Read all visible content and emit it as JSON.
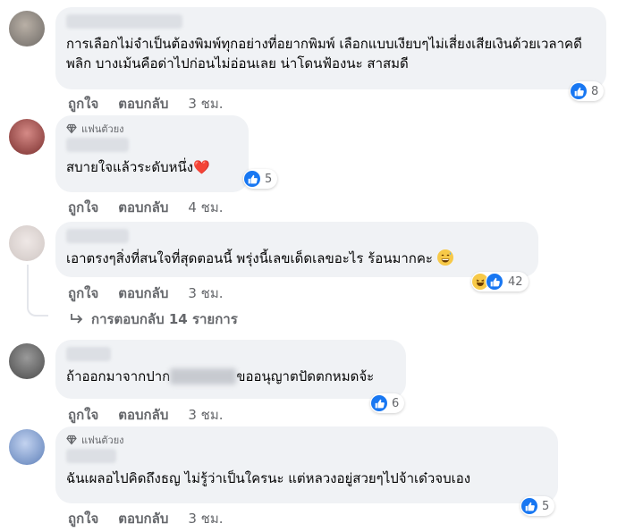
{
  "comments": [
    {
      "badge": "",
      "text": "การเลือกไม่จำเป็นต้องพิมพ์ทุกอย่างที่อยากพิมพ์ เลือกแบบเงียบๆไม่เสี่ยงเสียเงินด้วยเวลาคดีพลิก บางเม้นคือด่าไปก่อนไม่อ่อนเลย น่าโดนฟ้องนะ สาสมดี",
      "reaction_count": "8",
      "like_label": "ถูกใจ",
      "reply_label": "ตอบกลับ",
      "time": "3 ชม."
    },
    {
      "badge": "แฟนตัวยง",
      "text": "สบายใจแล้วระดับหนึ่ง",
      "emoji": "❤️",
      "reaction_count": "5",
      "like_label": "ถูกใจ",
      "reply_label": "ตอบกลับ",
      "time": "4 ชม."
    },
    {
      "badge": "",
      "text": "เอาตรงๆสิ่งที่สนใจที่สุดตอนนี้ พรุ่งนี้เลขเด็ดเลขอะไร ร้อนมากคะ",
      "reaction_count": "42",
      "like_label": "ถูกใจ",
      "reply_label": "ตอบกลับ",
      "time": "3 ชม.",
      "replies_label": "การตอบกลับ 14 รายการ"
    },
    {
      "badge": "",
      "text_before": "ถ้าออกมาจากปาก",
      "text_after": "ขออนุญาตปัดตกหมดจ้ะ",
      "reaction_count": "6",
      "like_label": "ถูกใจ",
      "reply_label": "ตอบกลับ",
      "time": "3 ชม."
    },
    {
      "badge": "แฟนตัวยง",
      "text": "ฉันเผลอไปคิดถึงธญ ไม่รู้ว่าเป็นใครนะ แต่หลวงอยู่สวยๆไปจ้าเด๋วจบเอง",
      "reaction_count": "5",
      "like_label": "ถูกใจ",
      "reply_label": "ตอบกลับ",
      "time": "3 ชม."
    }
  ],
  "colors": {
    "bubble": "#f0f2f5",
    "like_blue": "#1877f2",
    "meta_gray": "#65676b"
  }
}
